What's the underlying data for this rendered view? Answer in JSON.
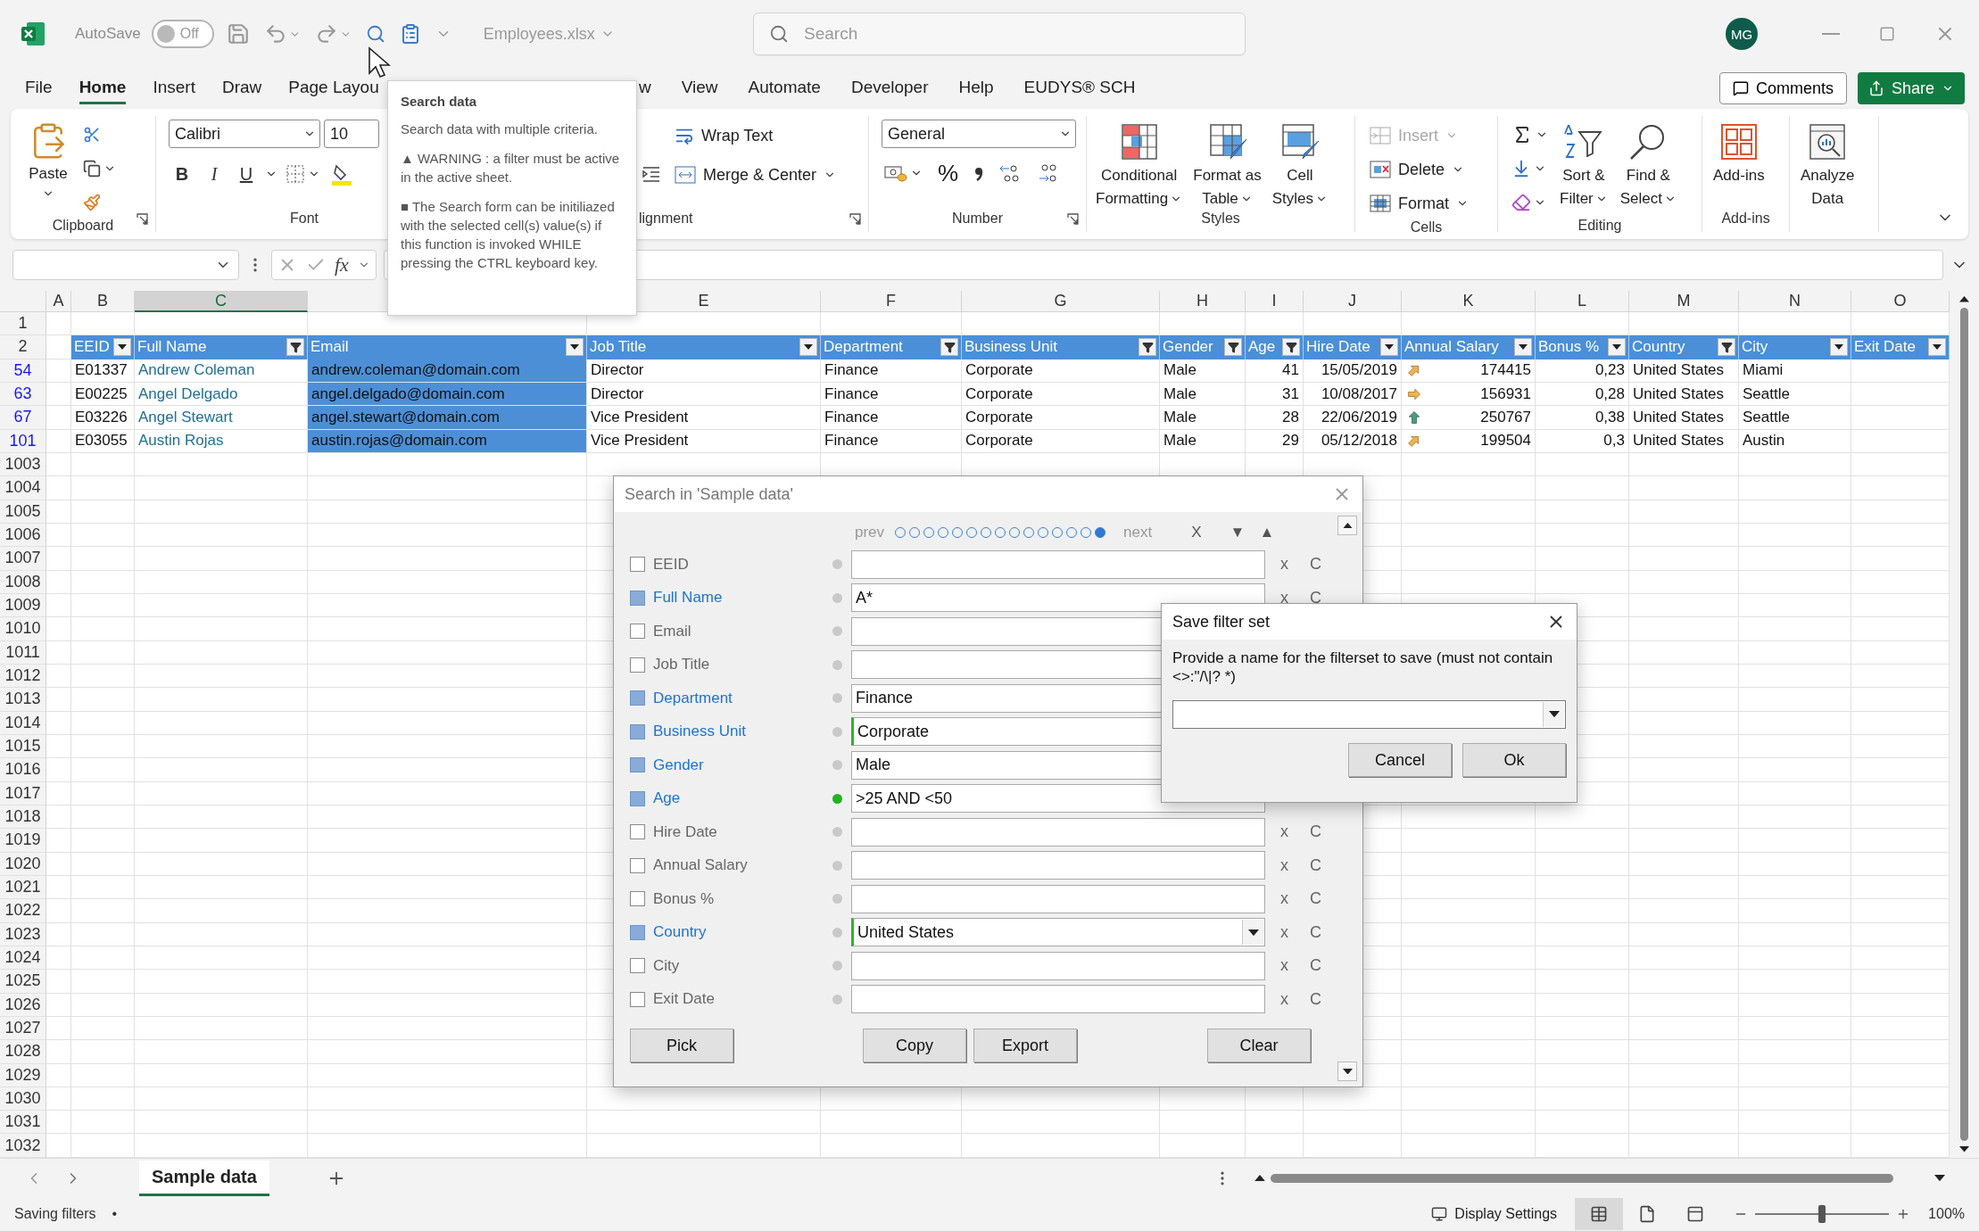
{
  "title_bar": {
    "autosave_label": "AutoSave",
    "autosave": {
      "on": false,
      "label": "Off"
    },
    "file_name": "Employees.xlsx",
    "search_placeholder": "Search",
    "avatar": "MG"
  },
  "menu": {
    "tabs": [
      {
        "label": "File",
        "selected": false
      },
      {
        "label": "Home",
        "selected": true
      },
      {
        "label": "Insert",
        "selected": false
      },
      {
        "label": "Draw",
        "selected": false
      },
      {
        "label": "Page Layou",
        "selected": false
      }
    ],
    "tabs_right": [
      {
        "label": "w",
        "selected": false
      },
      {
        "label": "View",
        "selected": false
      },
      {
        "label": "Automate",
        "selected": false
      },
      {
        "label": "Developer",
        "selected": false
      },
      {
        "label": "Help",
        "selected": false
      },
      {
        "label": "EUDYS® SCH",
        "selected": false
      }
    ],
    "comments": "Comments",
    "share": "Share"
  },
  "ribbon": {
    "clipboard": {
      "paste": "Paste",
      "label": "Clipboard"
    },
    "font": {
      "name": "Calibri",
      "size": "10",
      "bold": "B",
      "italic": "I",
      "underline": "U",
      "label": "Font"
    },
    "alignment": {
      "wrap": "Wrap Text",
      "merge": "Merge & Center",
      "label": "lignment"
    },
    "number": {
      "format": "General",
      "percent": "%",
      "label": "Number"
    },
    "styles": {
      "items": [
        {
          "kind": "conditional",
          "lines": [
            "Conditional",
            "Formatting"
          ]
        },
        {
          "kind": "table",
          "lines": [
            "Format as",
            "Table"
          ]
        },
        {
          "kind": "cell-styles",
          "lines": [
            "Cell",
            "Styles"
          ]
        }
      ],
      "label": "Styles"
    },
    "cells": {
      "items": [
        {
          "kind": "insert",
          "label": "Insert",
          "disabled": true
        },
        {
          "kind": "delete",
          "label": "Delete",
          "disabled": false
        },
        {
          "kind": "format",
          "label": "Format",
          "disabled": false
        }
      ],
      "label": "Cells"
    },
    "editing": {
      "items": [
        {
          "kind": "sort",
          "lines": [
            "Sort &",
            "Filter"
          ]
        },
        {
          "kind": "find",
          "lines": [
            "Find &",
            "Select"
          ]
        }
      ],
      "label": "Editing"
    },
    "addins": {
      "button": "Add-ins",
      "label": "Add-ins"
    },
    "analyze": {
      "lines": [
        "Analyze",
        "Data"
      ]
    }
  },
  "formula_bar": {
    "function_label": "fx"
  },
  "sheet": {
    "columns": [
      {
        "letter": "A",
        "selected": false
      },
      {
        "letter": "B",
        "selected": false
      },
      {
        "letter": "C",
        "selected": true
      },
      {
        "selected": false
      },
      {
        "letter": "E",
        "selected": false
      },
      {
        "letter": "F",
        "selected": false
      },
      {
        "letter": "G",
        "selected": false
      },
      {
        "letter": "H",
        "selected": false
      },
      {
        "letter": "I",
        "selected": false
      },
      {
        "letter": "J",
        "selected": false
      },
      {
        "letter": "K",
        "selected": false
      },
      {
        "letter": "L",
        "selected": false
      },
      {
        "letter": "M",
        "selected": false
      },
      {
        "letter": "N",
        "selected": false
      },
      {
        "letter": "O",
        "selected": false
      }
    ],
    "headers": [
      {
        "label": "EEID",
        "filtered": false,
        "kind": "text",
        "selected": false
      },
      {
        "label": "Full Name",
        "filtered": true,
        "kind": "name",
        "selected": false
      },
      {
        "label": "Email",
        "filtered": false,
        "kind": "text",
        "selected": true
      },
      {
        "label": "Job Title",
        "filtered": false,
        "kind": "text",
        "selected": false
      },
      {
        "label": "Department",
        "filtered": true,
        "kind": "text",
        "selected": false
      },
      {
        "label": "Business Unit",
        "filtered": true,
        "kind": "text",
        "selected": false
      },
      {
        "label": "Gender",
        "filtered": true,
        "kind": "text",
        "selected": false
      },
      {
        "label": "Age",
        "filtered": true,
        "kind": "number",
        "selected": false
      },
      {
        "label": "Hire Date",
        "filtered": false,
        "kind": "number",
        "selected": false
      },
      {
        "label": "Annual Salary",
        "filtered": false,
        "kind": "trend",
        "selected": false
      },
      {
        "label": "Bonus %",
        "filtered": false,
        "kind": "number",
        "selected": false
      },
      {
        "label": "Country",
        "filtered": true,
        "kind": "text",
        "selected": false
      },
      {
        "label": "City",
        "filtered": false,
        "kind": "text",
        "selected": false
      },
      {
        "label": "Exit Date",
        "filtered": false,
        "kind": "text",
        "selected": false
      }
    ],
    "rows": [
      {
        "number": "1",
        "matched": false,
        "kind": "empty"
      },
      {
        "number": "2",
        "matched": false,
        "kind": "header"
      },
      {
        "number": "54",
        "matched": true,
        "kind": "data",
        "trend": {
          "kind": "up-right"
        },
        "cells": [
          "E01337",
          "Andrew Coleman",
          "andrew.coleman@domain.com",
          "Director",
          "Finance",
          "Corporate",
          "Male",
          "41",
          "15/05/2019",
          "174415",
          "0,23",
          "United States",
          "Miami"
        ]
      },
      {
        "number": "63",
        "matched": true,
        "kind": "data",
        "trend": {
          "kind": "right"
        },
        "cells": [
          "E00225",
          "Angel Delgado",
          "angel.delgado@domain.com",
          "Director",
          "Finance",
          "Corporate",
          "Male",
          "31",
          "10/08/2017",
          "156931",
          "0,28",
          "United States",
          "Seattle"
        ]
      },
      {
        "number": "67",
        "matched": true,
        "kind": "data",
        "trend": {
          "kind": "up"
        },
        "cells": [
          "E03226",
          "Angel Stewart",
          "angel.stewart@domain.com",
          "Vice President",
          "Finance",
          "Corporate",
          "Male",
          "28",
          "22/06/2019",
          "250767",
          "0,38",
          "United States",
          "Seattle"
        ]
      },
      {
        "number": "101",
        "matched": true,
        "kind": "data",
        "trend": {
          "kind": "up-right"
        },
        "cells": [
          "E03055",
          "Austin Rojas",
          "austin.rojas@domain.com",
          "Vice President",
          "Finance",
          "Corporate",
          "Male",
          "29",
          "05/12/2018",
          "199504",
          "0,3",
          "United States",
          "Austin"
        ]
      },
      {
        "number": "1003",
        "matched": false,
        "kind": "empty"
      },
      {
        "number": "1004",
        "matched": false,
        "kind": "empty"
      },
      {
        "number": "1005",
        "matched": false,
        "kind": "empty"
      },
      {
        "number": "1006",
        "matched": false,
        "kind": "empty"
      },
      {
        "number": "1007",
        "matched": false,
        "kind": "empty"
      },
      {
        "number": "1008",
        "matched": false,
        "kind": "empty"
      },
      {
        "number": "1009",
        "matched": false,
        "kind": "empty"
      },
      {
        "number": "1010",
        "matched": false,
        "kind": "empty"
      },
      {
        "number": "1011",
        "matched": false,
        "kind": "empty"
      },
      {
        "number": "1012",
        "matched": false,
        "kind": "empty"
      },
      {
        "number": "1013",
        "matched": false,
        "kind": "empty"
      },
      {
        "number": "1014",
        "matched": false,
        "kind": "empty"
      },
      {
        "number": "1015",
        "matched": false,
        "kind": "empty"
      },
      {
        "number": "1016",
        "matched": false,
        "kind": "empty"
      },
      {
        "number": "1017",
        "matched": false,
        "kind": "empty"
      },
      {
        "number": "1018",
        "matched": false,
        "kind": "empty"
      },
      {
        "number": "1019",
        "matched": false,
        "kind": "empty"
      },
      {
        "number": "1020",
        "matched": false,
        "kind": "empty"
      },
      {
        "number": "1021",
        "matched": false,
        "kind": "empty"
      },
      {
        "number": "1022",
        "matched": false,
        "kind": "empty"
      },
      {
        "number": "1023",
        "matched": false,
        "kind": "empty"
      },
      {
        "number": "1024",
        "matched": false,
        "kind": "empty"
      },
      {
        "number": "1025",
        "matched": false,
        "kind": "empty"
      },
      {
        "number": "1026",
        "matched": false,
        "kind": "empty"
      },
      {
        "number": "1027",
        "matched": false,
        "kind": "empty"
      },
      {
        "number": "1028",
        "matched": false,
        "kind": "empty"
      },
      {
        "number": "1029",
        "matched": false,
        "kind": "empty"
      },
      {
        "number": "1030",
        "matched": false,
        "kind": "empty"
      },
      {
        "number": "1031",
        "matched": false,
        "kind": "empty"
      },
      {
        "number": "1032",
        "matched": false,
        "kind": "empty"
      }
    ]
  },
  "sheet_tabs": [
    {
      "label": "Sample data",
      "selected": true
    }
  ],
  "status_bar": {
    "message": "Saving filters",
    "indicator": "•",
    "display_settings": "Display Settings",
    "views": [
      {
        "kind": "normal",
        "selected": true
      },
      {
        "kind": "page-layout",
        "selected": false
      },
      {
        "kind": "page-break",
        "selected": false
      }
    ],
    "zoom": {
      "level": 0.5,
      "label": "100%"
    }
  },
  "tooltip": {
    "title": "Search data",
    "paragraphs": [
      "Search data with multiple criteria.",
      "▲ WARNING : a filter must be active in the active sheet.",
      "■ The Search form can be initiliazed with the selected cell(s) value(s) if this function is invoked WHILE pressing the CTRL keyboard key."
    ]
  },
  "search_dialog": {
    "title": "Search in 'Sample data'",
    "nav": {
      "prev": "prev",
      "next": "next",
      "clear": "X",
      "down": "▼",
      "up": "▲",
      "pages": [
        {
          "selected": false
        },
        {
          "selected": false
        },
        {
          "selected": false
        },
        {
          "selected": false
        },
        {
          "selected": false
        },
        {
          "selected": false
        },
        {
          "selected": false
        },
        {
          "selected": false
        },
        {
          "selected": false
        },
        {
          "selected": false
        },
        {
          "selected": false
        },
        {
          "selected": false
        },
        {
          "selected": false
        },
        {
          "selected": false
        },
        {
          "selected": true
        }
      ]
    },
    "filters": [
      {
        "label": "EEID",
        "checked": false,
        "active": false,
        "kind": "text",
        "edited": false,
        "actions": [
          "x",
          "C"
        ]
      },
      {
        "label": "Full Name",
        "checked": true,
        "active": false,
        "kind": "text",
        "value": "A*",
        "edited": false,
        "actions": [
          "x",
          "C"
        ]
      },
      {
        "label": "Email",
        "checked": false,
        "active": false,
        "kind": "text",
        "edited": false
      },
      {
        "label": "Job Title",
        "checked": false,
        "active": false,
        "kind": "text",
        "edited": false
      },
      {
        "label": "Department",
        "checked": true,
        "active": false,
        "kind": "text",
        "value": "Finance",
        "edited": false
      },
      {
        "label": "Business Unit",
        "checked": true,
        "active": false,
        "kind": "text",
        "value": "Corporate",
        "edited": true
      },
      {
        "label": "Gender",
        "checked": true,
        "active": false,
        "kind": "text",
        "value": "Male",
        "edited": false
      },
      {
        "label": "Age",
        "checked": true,
        "active": true,
        "kind": "text",
        "value": ">25 AND <50",
        "edited": false
      },
      {
        "label": "Hire Date",
        "checked": false,
        "active": false,
        "kind": "text",
        "edited": false,
        "actions": [
          "x",
          "C"
        ]
      },
      {
        "label": "Annual Salary",
        "checked": false,
        "active": false,
        "kind": "text",
        "edited": false,
        "actions": [
          "x",
          "C"
        ]
      },
      {
        "label": "Bonus %",
        "checked": false,
        "active": false,
        "kind": "text",
        "edited": false,
        "actions": [
          "x",
          "C"
        ]
      },
      {
        "label": "Country",
        "checked": true,
        "active": false,
        "kind": "combo",
        "value": "United States",
        "edited": true,
        "actions": [
          "x",
          "C"
        ]
      },
      {
        "label": "City",
        "checked": false,
        "active": false,
        "kind": "text",
        "edited": false,
        "actions": [
          "x",
          "C"
        ]
      },
      {
        "label": "Exit Date",
        "checked": false,
        "active": false,
        "kind": "text",
        "edited": false,
        "actions": [
          "x",
          "C"
        ]
      }
    ],
    "buttons": {
      "left": [
        "Pick"
      ],
      "middle": [
        "Copy",
        "Export"
      ],
      "right": [
        "Clear"
      ]
    }
  },
  "save_dialog": {
    "title": "Save filter set",
    "message": "Provide a name for the filterset to save (must not contain <>:\"/\\|? *)",
    "buttons": [
      "Cancel",
      "Ok"
    ]
  }
}
